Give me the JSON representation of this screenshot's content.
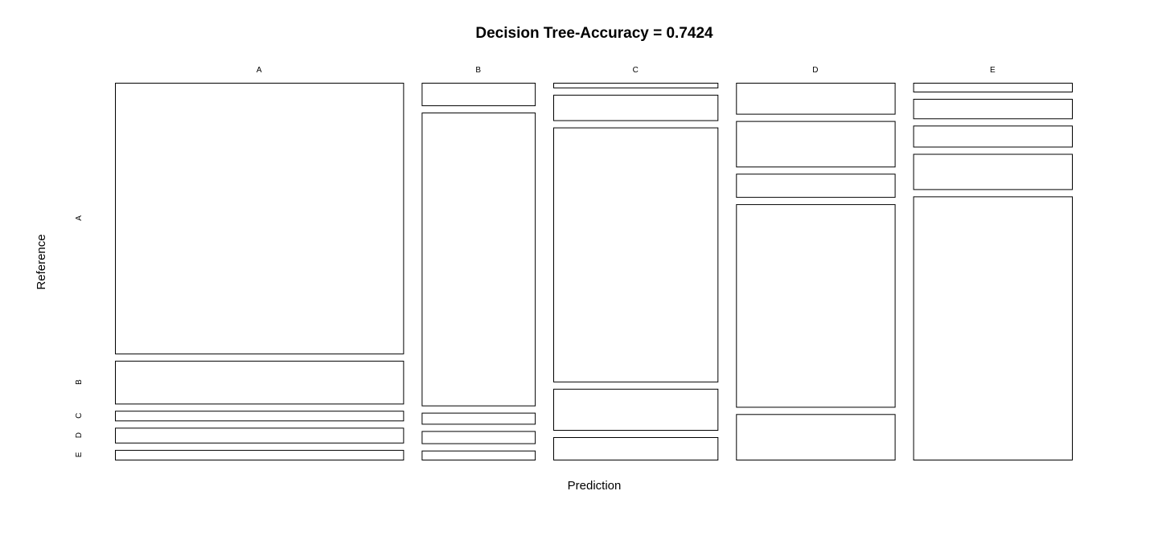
{
  "chart_data": {
    "type": "mosaic",
    "title": "Decision Tree-Accuracy = 0.7424",
    "xlabel": "Prediction",
    "ylabel": "Reference",
    "prediction_classes": [
      "A",
      "B",
      "C",
      "D",
      "E"
    ],
    "reference_classes": [
      "A",
      "B",
      "C",
      "D",
      "E"
    ],
    "column_share": [
      0.3284,
      0.1289,
      0.1872,
      0.1808,
      0.1809
    ],
    "cell_share_by_prediction": {
      "A": [
        0.7253,
        0.1149,
        0.0261,
        0.0399,
        0.0261
      ],
      "B": [
        0.0601,
        0.7807,
        0.0296,
        0.0326,
        0.0243
      ],
      "C": [
        0.0128,
        0.0693,
        0.6907,
        0.1118,
        0.0612
      ],
      "D": [
        0.0842,
        0.1236,
        0.063,
        0.5503,
        0.1236
      ],
      "E": [
        0.0236,
        0.0519,
        0.056,
        0.0938,
        0.7007
      ]
    }
  }
}
